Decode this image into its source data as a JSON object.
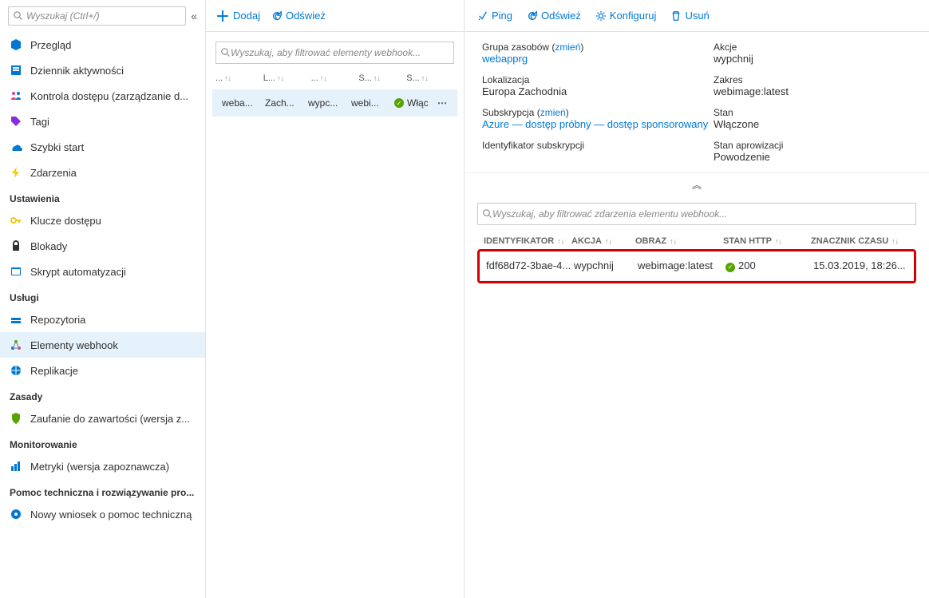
{
  "sidebar": {
    "search_placeholder": "Wyszukaj (Ctrl+/)",
    "items": [
      {
        "label": "Przegląd",
        "icon": "cube"
      },
      {
        "label": "Dziennik aktywności",
        "icon": "log"
      },
      {
        "label": "Kontrola dostępu (zarządzanie d...",
        "icon": "people"
      },
      {
        "label": "Tagi",
        "icon": "tag"
      },
      {
        "label": "Szybki start",
        "icon": "cloud"
      },
      {
        "label": "Zdarzenia",
        "icon": "bolt"
      }
    ],
    "sections": {
      "settings": "Ustawienia",
      "services": "Usługi",
      "policies": "Zasady",
      "monitoring": "Monitorowanie",
      "support": "Pomoc techniczna i rozwiązywanie pro..."
    },
    "settings_items": [
      {
        "label": "Klucze dostępu",
        "icon": "key"
      },
      {
        "label": "Blokady",
        "icon": "lock"
      },
      {
        "label": "Skrypt automatyzacji",
        "icon": "script"
      }
    ],
    "services_items": [
      {
        "label": "Repozytoria",
        "icon": "repo"
      },
      {
        "label": "Elementy webhook",
        "icon": "webhook",
        "selected": true
      },
      {
        "label": "Replikacje",
        "icon": "globe"
      }
    ],
    "policies_items": [
      {
        "label": "Zaufanie do zawartości (wersja z...",
        "icon": "shield"
      }
    ],
    "monitoring_items": [
      {
        "label": "Metryki (wersja zapoznawcza)",
        "icon": "chart"
      }
    ],
    "support_items": [
      {
        "label": "Nowy wniosek o pomoc techniczną",
        "icon": "support"
      }
    ]
  },
  "mid": {
    "add_label": "Dodaj",
    "refresh_label": "Odśwież",
    "filter_placeholder": "Wyszukaj, aby filtrować elementy webhook...",
    "headers": [
      "...",
      "L...",
      "...",
      "S...",
      "S..."
    ],
    "row": {
      "name": "weba...",
      "loc": "Zach...",
      "action": "wypc...",
      "image": "webi...",
      "status": "Włąc"
    }
  },
  "right_toolbar": {
    "ping": "Ping",
    "refresh": "Odśwież",
    "configure": "Konfiguruj",
    "delete": "Usuń"
  },
  "props": {
    "resource_group_label": "Grupa zasobów",
    "change": "zmień",
    "resource_group_val": "webapprg",
    "actions_label": "Akcje",
    "actions_val": "wypchnij",
    "location_label": "Lokalizacja",
    "location_val": "Europa Zachodnia",
    "scope_label": "Zakres",
    "scope_val": "webimage:latest",
    "subscription_label": "Subskrypcja",
    "subscription_val": "Azure — dostęp próbny — dostęp sponsorowany",
    "state_label": "Stan",
    "state_val": "Włączone",
    "subid_label": "Identyfikator subskrypcji",
    "prov_label": "Stan aprowizacji",
    "prov_val": "Powodzenie"
  },
  "events": {
    "filter_placeholder": "Wyszukaj, aby filtrować zdarzenia elementu webhook...",
    "headers": {
      "id": "IDENTYFIKATOR",
      "action": "AKCJA",
      "image": "OBRAZ",
      "status": "STAN HTTP",
      "time": "ZNACZNIK CZASU"
    },
    "row": {
      "id": "fdf68d72-3bae-4...",
      "action": "wypchnij",
      "image": "webimage:latest",
      "status": "200",
      "time": "15.03.2019, 18:26..."
    }
  }
}
